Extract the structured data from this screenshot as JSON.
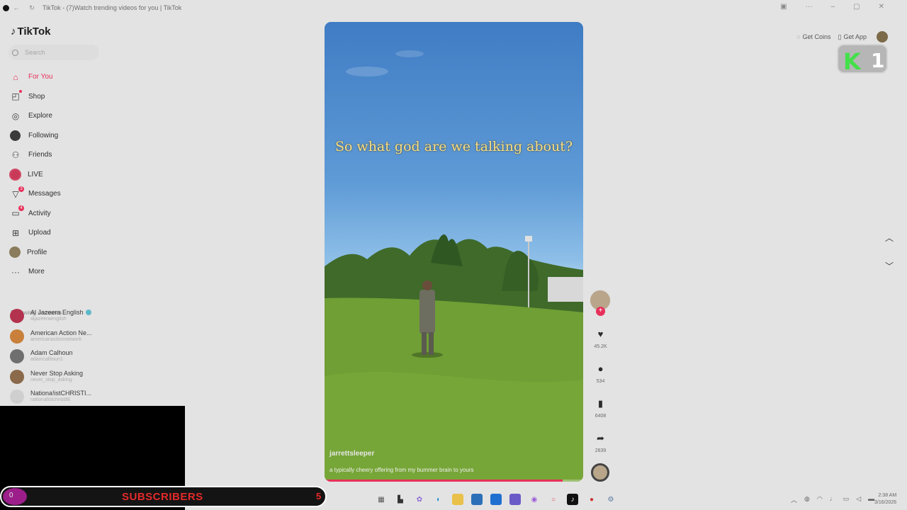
{
  "window": {
    "title": "TikTok - (7)Watch trending videos for you | TikTok"
  },
  "sidebar": {
    "brand": "TikTok",
    "search_placeholder": "Search",
    "nav": [
      {
        "label": "For You",
        "icon": "home-icon",
        "active": true
      },
      {
        "label": "Shop",
        "icon": "shopping-bag-icon"
      },
      {
        "label": "Explore",
        "icon": "compass-icon"
      },
      {
        "label": "Following",
        "icon": "following-avatar-icon"
      },
      {
        "label": "Friends",
        "icon": "friends-icon"
      },
      {
        "label": "LIVE",
        "icon": "live-icon"
      },
      {
        "label": "Messages",
        "icon": "paper-plane-icon",
        "badge": "3"
      },
      {
        "label": "Activity",
        "icon": "inbox-icon",
        "badge": "4"
      },
      {
        "label": "Upload",
        "icon": "plus-square-icon"
      },
      {
        "label": "Profile",
        "icon": "profile-avatar-icon"
      },
      {
        "label": "More",
        "icon": "ellipsis-icon"
      }
    ],
    "following_header": "Following accounts",
    "accounts": [
      {
        "name": "Al Jazeera English",
        "handle": "aljazeeraenglish",
        "verified": true,
        "color": "#b3324d"
      },
      {
        "name": "American Action Ne...",
        "handle": "americanactionnetwork",
        "color": "#c8803a"
      },
      {
        "name": "Adam Calhoun",
        "handle": "adamcalhoun1",
        "color": "#6f6f6f"
      },
      {
        "name": "Never Stop Asking",
        "handle": "never_stop_asking",
        "color": "#8a6a4a"
      },
      {
        "name": "Nationa!istCHRISTI...",
        "handle": "nationalistchrist88",
        "color": "#cfcfcf"
      }
    ]
  },
  "overlay": {
    "subscribers_label": "SUBSCRIBERS",
    "subscribers_count": "5",
    "subscribers_icon_text": "0"
  },
  "video": {
    "caption": "So what god are we talking about?",
    "author": "jarrettsleeper",
    "description": "a typically cheery offering from my bummer brain to yours",
    "progress": 0.92
  },
  "actions": {
    "likes": "45.2K",
    "comments": "534",
    "saves": "6408",
    "shares": "2839"
  },
  "topbar": {
    "get_coins": "Get Coins",
    "get_app": "Get App"
  },
  "k1_badge": {
    "letter": "K",
    "number": "1"
  },
  "taskbar": {
    "time": "2:38 AM",
    "date": "3/16/2026"
  }
}
